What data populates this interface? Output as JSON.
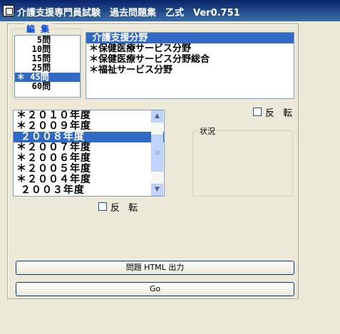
{
  "window": {
    "title": "介護支援専門員試験　過去問題集　乙式　Ver0.751"
  },
  "edit_group": {
    "label": "編 集",
    "counts": [
      {
        "text": "    5問",
        "selected": false
      },
      {
        "text": "   10問",
        "selected": false
      },
      {
        "text": "   15問",
        "selected": false
      },
      {
        "text": "   25問",
        "selected": false
      },
      {
        "text": "＊ 45問",
        "selected": true
      },
      {
        "text": "   60問",
        "selected": false
      }
    ]
  },
  "fields": [
    {
      "text": " 介護支援分野",
      "selected": true
    },
    {
      "text": "＊保健医療サービス分野",
      "selected": false
    },
    {
      "text": "＊保健医療サービス分野総合",
      "selected": false
    },
    {
      "text": "＊福祉サービス分野",
      "selected": false
    }
  ],
  "years": [
    {
      "text": "＊２０１０年度",
      "selected": false
    },
    {
      "text": "＊２００９年度",
      "selected": false
    },
    {
      "text": " ２００８年度",
      "selected": true
    },
    {
      "text": "＊２００７年度",
      "selected": false
    },
    {
      "text": "＊２００６年度",
      "selected": false
    },
    {
      "text": "＊２００５年度",
      "selected": false
    },
    {
      "text": "＊２００４年度",
      "selected": false
    },
    {
      "text": " ２００３年度",
      "selected": false
    }
  ],
  "invert_label_top": "反 転",
  "invert_label_bottom": "反 転",
  "status_group": {
    "label": "状況"
  },
  "buttons": {
    "html_output": "問題 HTML 出力",
    "go": "Go"
  }
}
